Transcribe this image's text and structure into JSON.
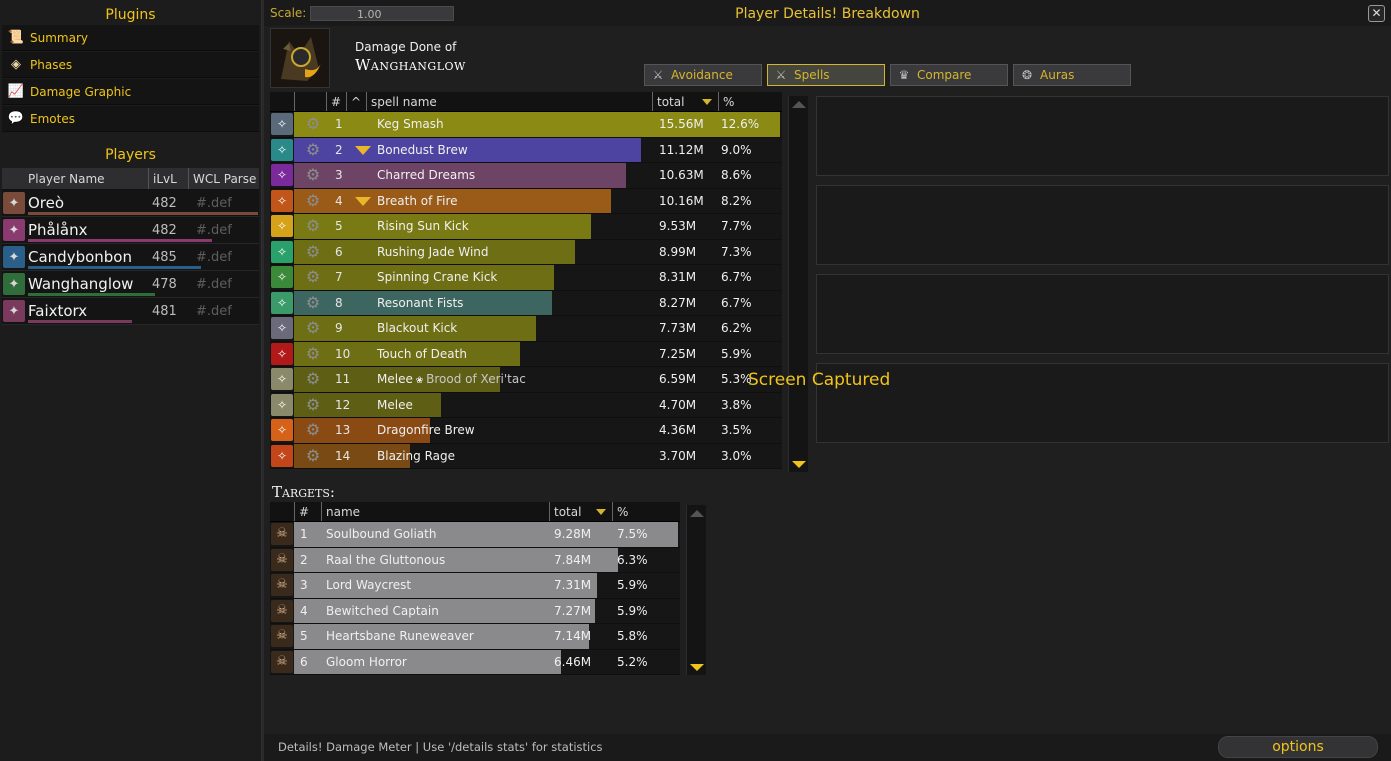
{
  "plugins": {
    "title": "Plugins",
    "items": [
      {
        "label": "Summary",
        "icon": "scroll-icon"
      },
      {
        "label": "Phases",
        "icon": "phases-icon"
      },
      {
        "label": "Damage Graphic",
        "icon": "graph-icon"
      },
      {
        "label": "Emotes",
        "icon": "speech-bubble-icon"
      }
    ]
  },
  "players": {
    "title": "Players",
    "headers": [
      "Player Name",
      "iLvL",
      "WCL Parse"
    ],
    "rows": [
      {
        "name": "Oreò",
        "ilvl": "482",
        "parse": "#.def",
        "color": "#7a4a3a",
        "bar": 1.0
      },
      {
        "name": "Phålånx",
        "ilvl": "482",
        "parse": "#.def",
        "color": "#8a3a6e",
        "bar": 0.8
      },
      {
        "name": "Candybonbon",
        "ilvl": "485",
        "parse": "#.def",
        "color": "#2a5f8a",
        "bar": 0.75
      },
      {
        "name": "Wanghanglow",
        "ilvl": "478",
        "parse": "#.def",
        "color": "#2f6e3a",
        "bar": 0.55
      },
      {
        "name": "Faixtorx",
        "ilvl": "481",
        "parse": "#.def",
        "color": "#7a3a5e",
        "bar": 0.45
      }
    ]
  },
  "window": {
    "scale_label": "Scale:",
    "scale_value": "1.00",
    "title": "Player Details! Breakdown",
    "close": "✕"
  },
  "player": {
    "damage_label": "Damage Done of",
    "name": "Wanghanglow"
  },
  "tabs": [
    {
      "label": "Avoidance",
      "icon": "swords-icon",
      "active": false
    },
    {
      "label": "Spells",
      "icon": "crossed-swords-icon",
      "active": true
    },
    {
      "label": "Compare",
      "icon": "crown-icon",
      "active": false
    },
    {
      "label": "Auras",
      "icon": "aura-icon",
      "active": false
    }
  ],
  "spells": {
    "headers": {
      "num": "#",
      "caret": "^",
      "name": "spell name",
      "total": "total",
      "pct": "%"
    },
    "rows": [
      {
        "num": "1",
        "name": "Keg Smash",
        "sub": "",
        "total": "15.56M",
        "pct": "12.6%",
        "expand": false,
        "color": "#8a8a14",
        "fill": 1.0,
        "icon_bg": "#5a6a7a"
      },
      {
        "num": "2",
        "name": "Bonedust Brew",
        "sub": "",
        "total": "11.12M",
        "pct": "9.0%",
        "expand": true,
        "color": "#4c44a0",
        "fill": 0.714,
        "icon_bg": "#2a8a8a"
      },
      {
        "num": "3",
        "name": "Charred Dreams",
        "sub": "",
        "total": "10.63M",
        "pct": "8.6%",
        "expand": false,
        "color": "#6e4466",
        "fill": 0.683,
        "icon_bg": "#7a2a9a"
      },
      {
        "num": "4",
        "name": "Breath of Fire",
        "sub": "",
        "total": "10.16M",
        "pct": "8.2%",
        "expand": true,
        "color": "#9a5a18",
        "fill": 0.653,
        "icon_bg": "#c2561a"
      },
      {
        "num": "5",
        "name": "Rising Sun Kick",
        "sub": "",
        "total": "9.53M",
        "pct": "7.7%",
        "expand": false,
        "color": "#7a7a14",
        "fill": 0.612,
        "icon_bg": "#d6a21a"
      },
      {
        "num": "6",
        "name": "Rushing Jade Wind",
        "sub": "",
        "total": "8.99M",
        "pct": "7.3%",
        "expand": false,
        "color": "#6e6e14",
        "fill": 0.578,
        "icon_bg": "#2aa06a"
      },
      {
        "num": "7",
        "name": "Spinning Crane Kick",
        "sub": "",
        "total": "8.31M",
        "pct": "6.7%",
        "expand": false,
        "color": "#6e6e14",
        "fill": 0.534,
        "icon_bg": "#3a8a3a"
      },
      {
        "num": "8",
        "name": "Resonant Fists",
        "sub": "",
        "total": "8.27M",
        "pct": "6.7%",
        "expand": false,
        "color": "#3e6660",
        "fill": 0.531,
        "icon_bg": "#3a9a6a"
      },
      {
        "num": "9",
        "name": "Blackout Kick",
        "sub": "",
        "total": "7.73M",
        "pct": "6.2%",
        "expand": false,
        "color": "#6e6e14",
        "fill": 0.497,
        "icon_bg": "#6a6a7a"
      },
      {
        "num": "10",
        "name": "Touch of Death",
        "sub": "",
        "total": "7.25M",
        "pct": "5.9%",
        "expand": false,
        "color": "#6e6e14",
        "fill": 0.466,
        "icon_bg": "#b21a1a"
      },
      {
        "num": "11",
        "name": "Melee",
        "sub": "Brood of Xeri'tac",
        "total": "6.59M",
        "pct": "5.3%",
        "expand": false,
        "color": "#5e5e14",
        "fill": 0.424,
        "icon_bg": "#8a8a6a"
      },
      {
        "num": "12",
        "name": "Melee",
        "sub": "",
        "total": "4.70M",
        "pct": "3.8%",
        "expand": false,
        "color": "#5e5e14",
        "fill": 0.302,
        "icon_bg": "#8a8a6a"
      },
      {
        "num": "13",
        "name": "Dragonfire Brew",
        "sub": "",
        "total": "4.36M",
        "pct": "3.5%",
        "expand": false,
        "color": "#8a4a14",
        "fill": 0.28,
        "icon_bg": "#d6621a"
      },
      {
        "num": "14",
        "name": "Blazing Rage",
        "sub": "",
        "total": "3.70M",
        "pct": "3.0%",
        "expand": false,
        "color": "#7a4a14",
        "fill": 0.238,
        "icon_bg": "#c2461a"
      }
    ]
  },
  "targets": {
    "title": "Targets:",
    "headers": {
      "num": "#",
      "name": "name",
      "total": "total",
      "pct": "%"
    },
    "rows": [
      {
        "num": "1",
        "name": "Soulbound Goliath",
        "total": "9.28M",
        "pct": "7.5%",
        "fill": 1.0
      },
      {
        "num": "2",
        "name": "Raal the Gluttonous",
        "total": "7.84M",
        "pct": "6.3%",
        "fill": 0.845
      },
      {
        "num": "3",
        "name": "Lord Waycrest",
        "total": "7.31M",
        "pct": "5.9%",
        "fill": 0.788
      },
      {
        "num": "4",
        "name": "Bewitched Captain",
        "total": "7.27M",
        "pct": "5.9%",
        "fill": 0.783
      },
      {
        "num": "5",
        "name": "Heartsbane Runeweaver",
        "total": "7.14M",
        "pct": "5.8%",
        "fill": 0.769
      },
      {
        "num": "6",
        "name": "Gloom Horror",
        "total": "6.46M",
        "pct": "5.2%",
        "fill": 0.696
      }
    ]
  },
  "overlay": {
    "captured": "Screen Captured"
  },
  "footer": {
    "text": "Details! Damage Meter | Use '/details stats' for statistics",
    "options": "options"
  }
}
